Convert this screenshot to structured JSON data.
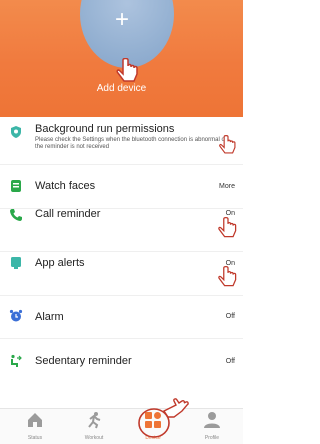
{
  "header": {
    "add_label": "Add device",
    "plus_glyph": "+"
  },
  "settings": [
    {
      "title": "Background run permissions",
      "description": "Please check the Settings when the bluetooth connection is abnormal or the reminder is not received",
      "icon": "shield-icon",
      "icon_color": "#3cb6a8"
    },
    {
      "title": "Watch faces",
      "value": "More",
      "icon": "watch-face-icon",
      "icon_color": "#2aa84a"
    },
    {
      "title": "Call reminder",
      "value": "On",
      "icon": "phone-icon",
      "icon_color": "#2aa84a"
    },
    {
      "title": "App alerts",
      "value": "On",
      "icon": "app-alert-icon",
      "icon_color": "#3cb6a8"
    },
    {
      "title": "Alarm",
      "value": "Off",
      "icon": "alarm-clock-icon",
      "icon_color": "#3b6fd6"
    },
    {
      "title": "Sedentary reminder",
      "value": "Off",
      "icon": "sedentary-icon",
      "icon_color": "#2aa84a"
    }
  ],
  "tabs": [
    {
      "label": "Status",
      "icon": "home-icon"
    },
    {
      "label": "Workout",
      "icon": "run-icon"
    },
    {
      "label": "Device",
      "icon": "device-grid-icon",
      "active": true
    },
    {
      "label": "Profile",
      "icon": "profile-icon"
    }
  ],
  "colors": {
    "accent": "#ee7436",
    "header_top": "#f38b4c"
  }
}
